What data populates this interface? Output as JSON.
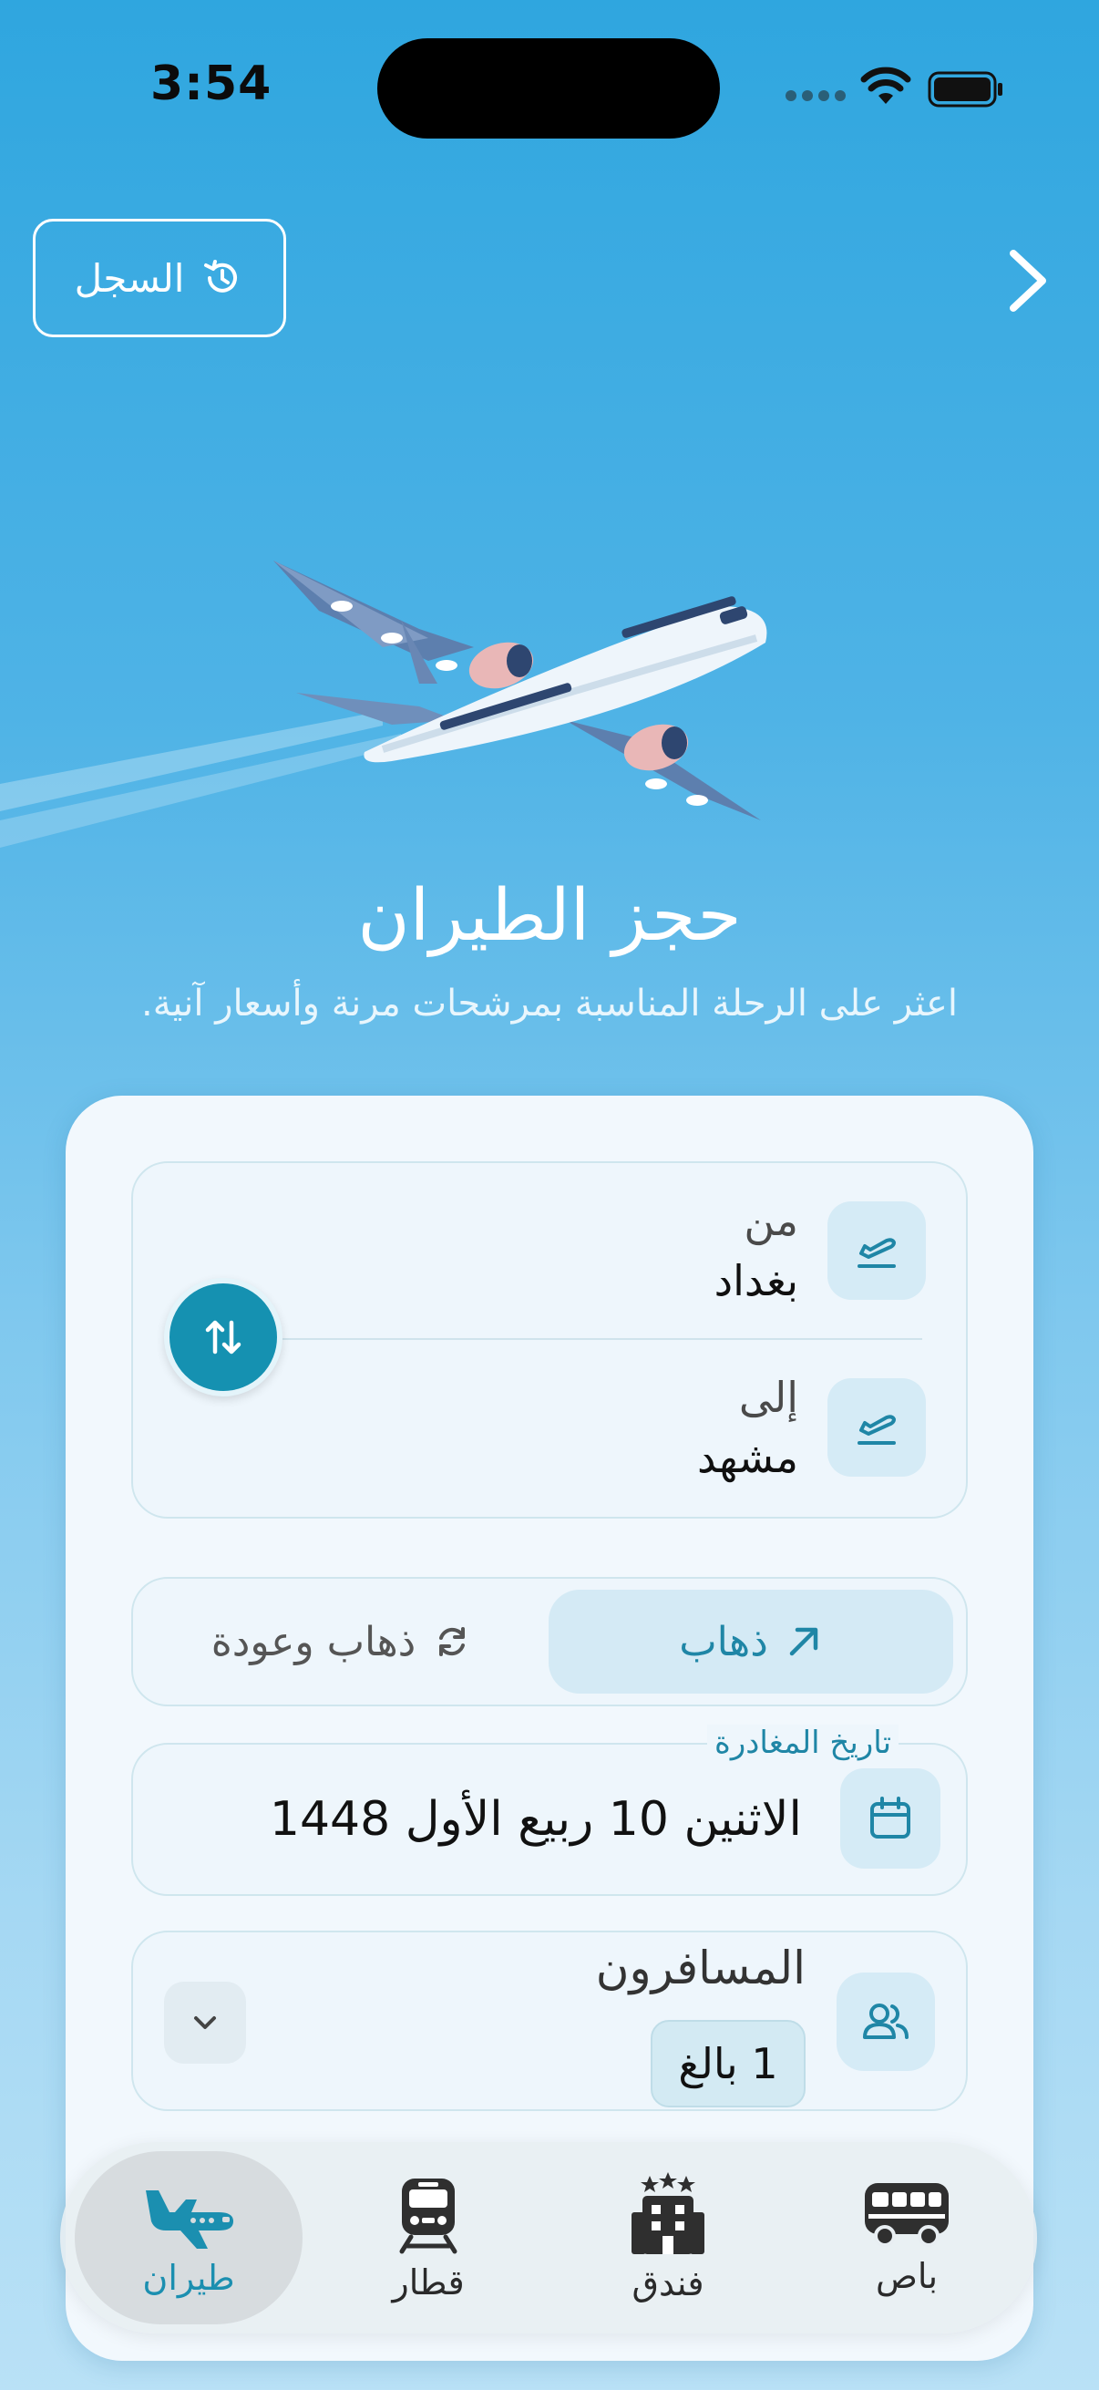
{
  "status_bar": {
    "time": "3:54"
  },
  "header": {
    "history_label": "السجل"
  },
  "hero": {
    "title": "حجز الطيران",
    "subtitle": "اعثر على الرحلة المناسبة بمرشحات مرنة وأسعار آنية."
  },
  "route": {
    "from_label": "من",
    "from_value": "بغداد",
    "to_label": "إلى",
    "to_value": "مشهد"
  },
  "trip_type": {
    "one_way": "ذهاب",
    "round_trip": "ذهاب وعودة",
    "selected": "ذهاب"
  },
  "departure": {
    "caption": "تاريخ المغادرة",
    "value": "الاثنين 10 ربيع الأول 1448"
  },
  "passengers": {
    "label": "المسافرون",
    "value": "1 بالغ"
  },
  "tabs": [
    {
      "label": "طيران",
      "icon": "plane-icon",
      "active": true
    },
    {
      "label": "قطار",
      "icon": "train-icon",
      "active": false
    },
    {
      "label": "فندق",
      "icon": "hotel-icon",
      "active": false
    },
    {
      "label": "باص",
      "icon": "bus-icon",
      "active": false
    }
  ],
  "colors": {
    "accent": "#1591b1",
    "accent_text": "#1f86a6"
  }
}
